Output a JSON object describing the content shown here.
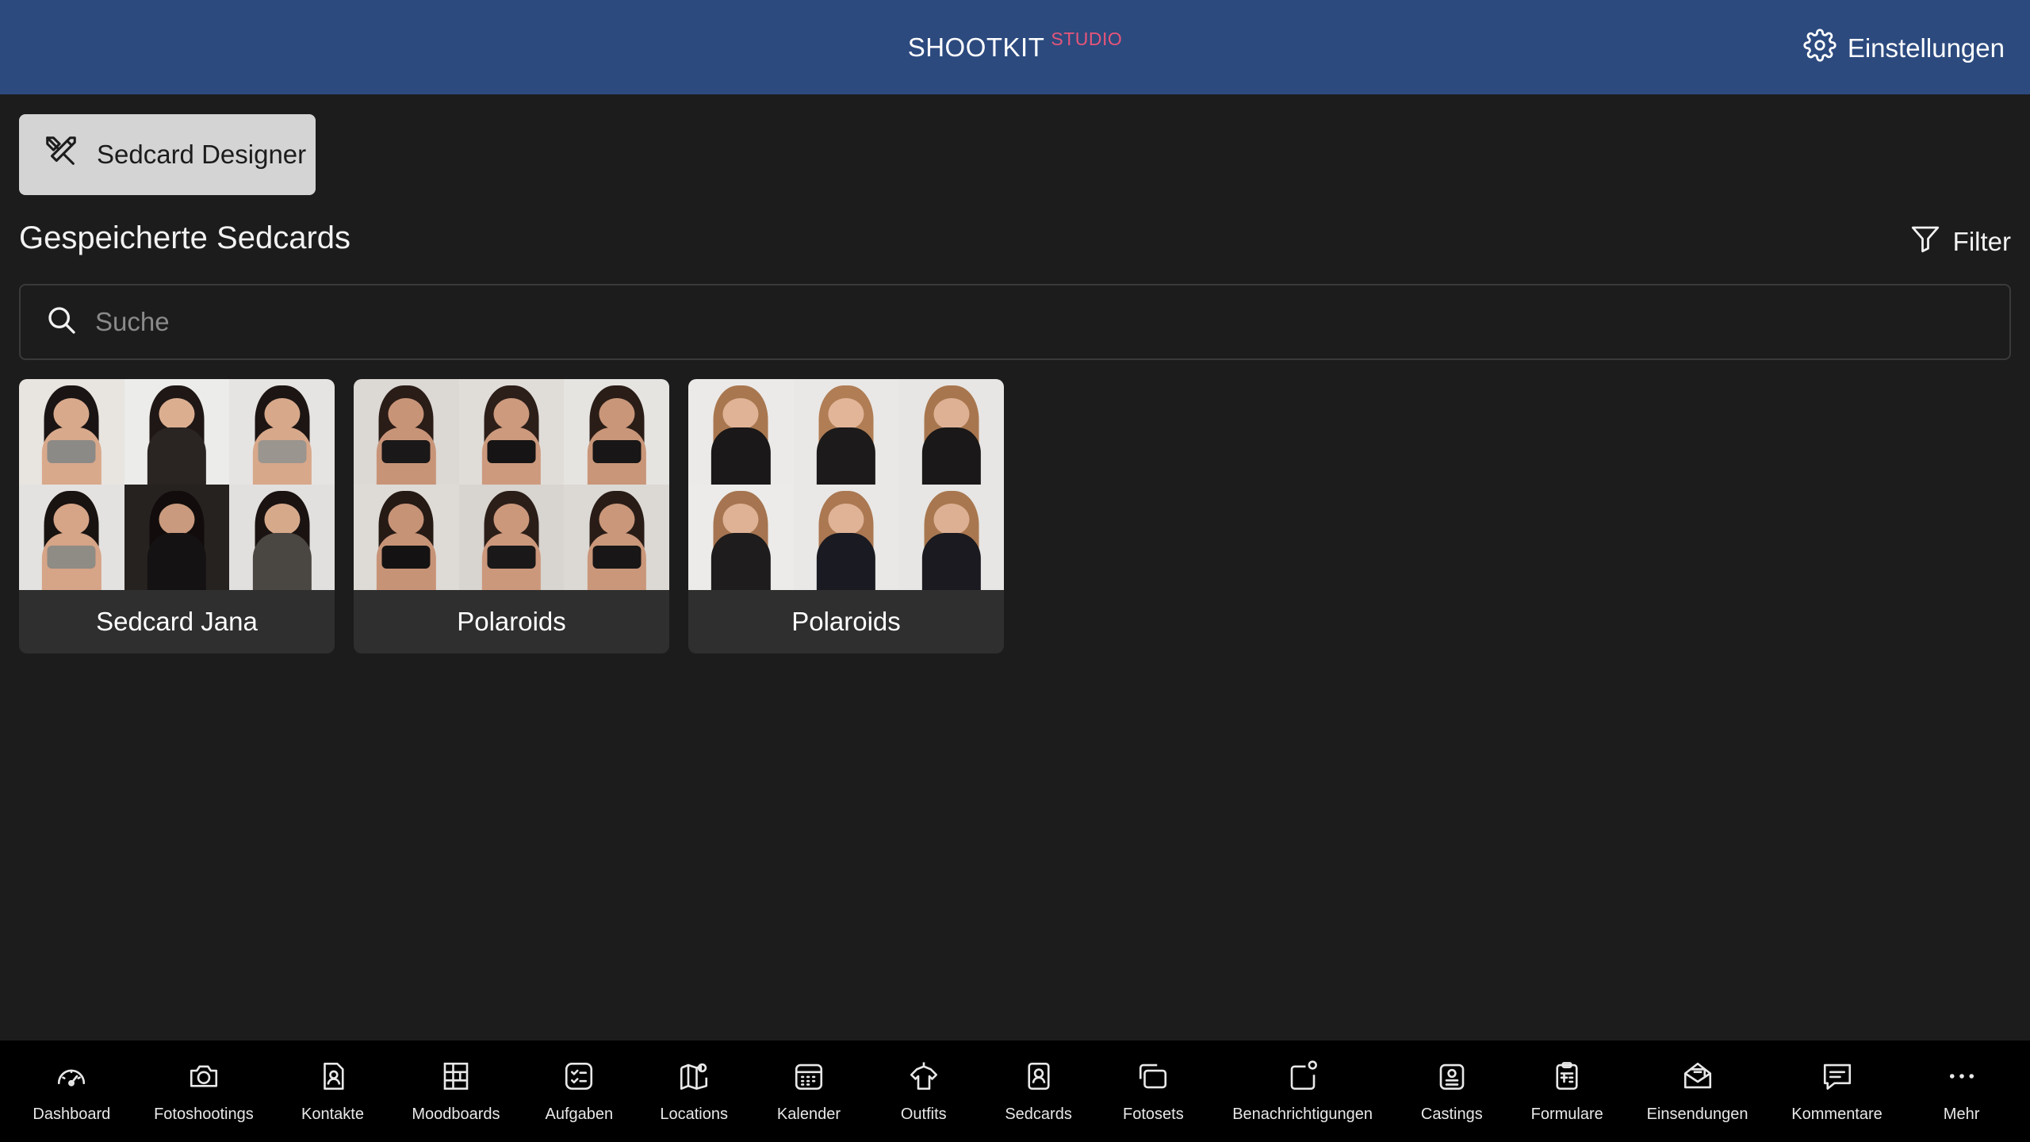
{
  "header": {
    "brand_main": "SHOOTKIT",
    "brand_sup": "STUDIO",
    "settings_label": "Einstellungen"
  },
  "designer_button": {
    "label": "Sedcard Designer"
  },
  "section": {
    "title": "Gespeicherte Sedcards",
    "filter_label": "Filter"
  },
  "search": {
    "placeholder": "Suche",
    "value": ""
  },
  "cards": [
    {
      "label": "Sedcard Jana"
    },
    {
      "label": "Polaroids"
    },
    {
      "label": "Polaroids"
    }
  ],
  "bottom_nav": [
    {
      "label": "Dashboard",
      "icon": "gauge-icon"
    },
    {
      "label": "Fotoshootings",
      "icon": "camera-icon"
    },
    {
      "label": "Kontakte",
      "icon": "contact-card-icon"
    },
    {
      "label": "Moodboards",
      "icon": "moodboard-grid-icon"
    },
    {
      "label": "Aufgaben",
      "icon": "checklist-icon"
    },
    {
      "label": "Locations",
      "icon": "map-pin-icon"
    },
    {
      "label": "Kalender",
      "icon": "calendar-icon"
    },
    {
      "label": "Outfits",
      "icon": "shirt-hanger-icon"
    },
    {
      "label": "Sedcards",
      "icon": "portrait-card-icon"
    },
    {
      "label": "Fotosets",
      "icon": "photo-stack-icon"
    },
    {
      "label": "Benachrichtigungen",
      "icon": "notification-badge-icon"
    },
    {
      "label": "Castings",
      "icon": "casting-badge-icon"
    },
    {
      "label": "Formulare",
      "icon": "clipboard-icon"
    },
    {
      "label": "Einsendungen",
      "icon": "envelope-icon"
    },
    {
      "label": "Kommentare",
      "icon": "comment-icon"
    },
    {
      "label": "Mehr",
      "icon": "more-dots-icon"
    }
  ],
  "colors": {
    "header_bg": "#2c4a7e",
    "brand_accent": "#e8557a",
    "page_bg": "#1c1c1c",
    "card_bg": "#2f2f2f",
    "nav_bg": "#000000"
  }
}
